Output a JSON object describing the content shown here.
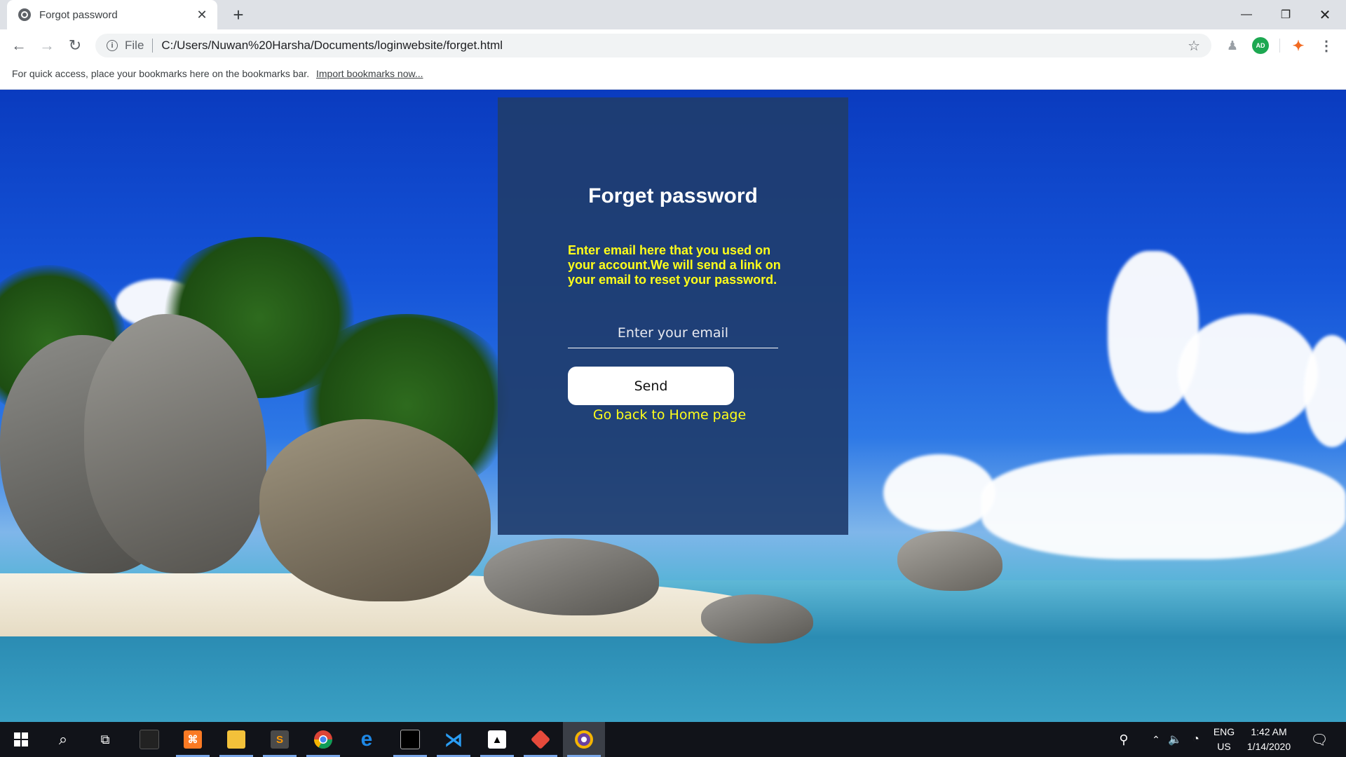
{
  "browser": {
    "tab_title": "Forgot password",
    "new_tab_symbol": "+",
    "scheme_label": "File",
    "url": "C:/Users/Nuwan%20Harsha/Documents/loginwebsite/forget.html",
    "bookmarks_bar_text": "For quick access, place your bookmarks here on the bookmarks bar.",
    "bookmarks_import_link": "Import bookmarks now...",
    "extension_badge": "AD"
  },
  "page": {
    "title": "Forget password",
    "description": "Enter email here that you used on your account.We will send a link on your email to reset your password.",
    "email_placeholder": "Enter your email",
    "send_label": "Send",
    "home_link": "Go back to Home page"
  },
  "taskbar": {
    "language_top": "ENG",
    "language_bottom": "US",
    "time": "1:42 AM",
    "date": "1/14/2020",
    "pinned_icons": [
      "windows-start-icon",
      "search-icon",
      "task-view-icon",
      "terminal-icon",
      "xampp-icon",
      "file-explorer-icon",
      "sublime-text-icon",
      "chrome-icon",
      "edge-icon",
      "command-prompt-icon",
      "vscode-icon",
      "photos-icon",
      "git-icon",
      "brave-icon"
    ]
  },
  "colors": {
    "card_bg": "#1f3d6e",
    "accent_yellow": "#ffff1a",
    "taskbar_bg": "#111319"
  }
}
